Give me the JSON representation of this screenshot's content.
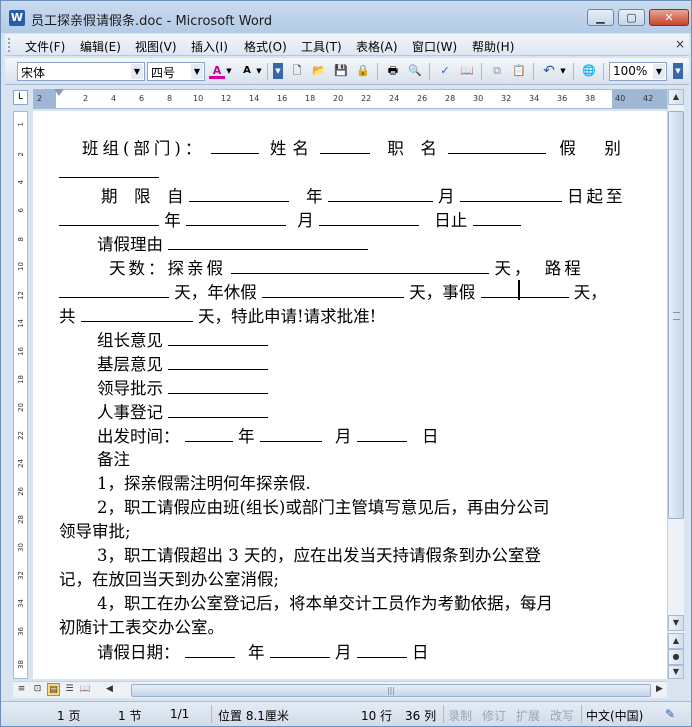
{
  "window": {
    "title": "员工探亲假请假条.doc - Microsoft Word",
    "minimize": "▁",
    "maximize": "▢",
    "close": "✕"
  },
  "menu": {
    "items": [
      "文件(F)",
      "编辑(E)",
      "视图(V)",
      "插入(I)",
      "格式(O)",
      "工具(T)",
      "表格(A)",
      "窗口(W)",
      "帮助(H)"
    ],
    "close_glyph": "×"
  },
  "toolbar": {
    "font": "宋体",
    "size": "四号",
    "zoom": "100%",
    "font_color_glyph": "A",
    "grow_glyph": "A"
  },
  "ruler": {
    "ticks": [
      "2",
      "2",
      "4",
      "6",
      "8",
      "10",
      "12",
      "14",
      "16",
      "18",
      "20",
      "22",
      "24",
      "26",
      "28",
      "30",
      "32",
      "34",
      "36",
      "38",
      "40",
      "42"
    ],
    "vticks": [
      "1",
      "2",
      "4",
      "6",
      "8",
      "10",
      "12",
      "14",
      "16",
      "18",
      "20",
      "22",
      "24",
      "26",
      "28",
      "30",
      "32",
      "34",
      "36",
      "38"
    ],
    "corner": "L"
  },
  "document": {
    "line1_a": "班组(部门)：",
    "line1_b": "姓名",
    "line1_c": "职　名",
    "line1_d": "假　别",
    "line3_a": "期　限　自",
    "line3_b": "年",
    "line3_c": "月",
    "line3_d": "日起至",
    "line4_a": "年",
    "line4_b": "月",
    "line4_c": "日止",
    "line5": "请假理由",
    "line6_a": "天数：探亲假",
    "line6_b": "天，　路程",
    "line7_a": "天，年休假",
    "line7_b": "天，事假",
    "line7_c": "天，",
    "line8_a": "共",
    "line8_b": "天，特此申请!请求批准!",
    "group": "组长意见",
    "base": "基层意见",
    "leader": "领导批示",
    "hr": "人事登记",
    "depart_a": "出发时间：",
    "depart_b": "年",
    "depart_c": "月",
    "depart_d": "日",
    "note": "备注",
    "n1": "1，探亲假需注明何年探亲假.",
    "n2a": "2，职工请假应由班(组长)或部门主管填写意见后，再由分公司",
    "n2b": "领导审批;",
    "n3a": "3，职工请假超出 3 天的，应在出发当天持请假条到办公室登",
    "n3b": "记，在放回当天到办公室消假;",
    "n4a": "4，职工在办公室登记后，将本单交计工员作为考勤依据，每月",
    "n4b": "初随计工表交办公室。",
    "date_a": "请假日期：",
    "date_b": "年",
    "date_c": "月",
    "date_d": "日"
  },
  "status": {
    "page": "1 页",
    "section": "1 节",
    "pages": "1/1",
    "position": "位置 8.1厘米",
    "line": "10 行",
    "column": "36 列",
    "rec": "录制",
    "trk": "修订",
    "ext": "扩展",
    "ovr": "改写",
    "lang": "中文(中国)"
  }
}
